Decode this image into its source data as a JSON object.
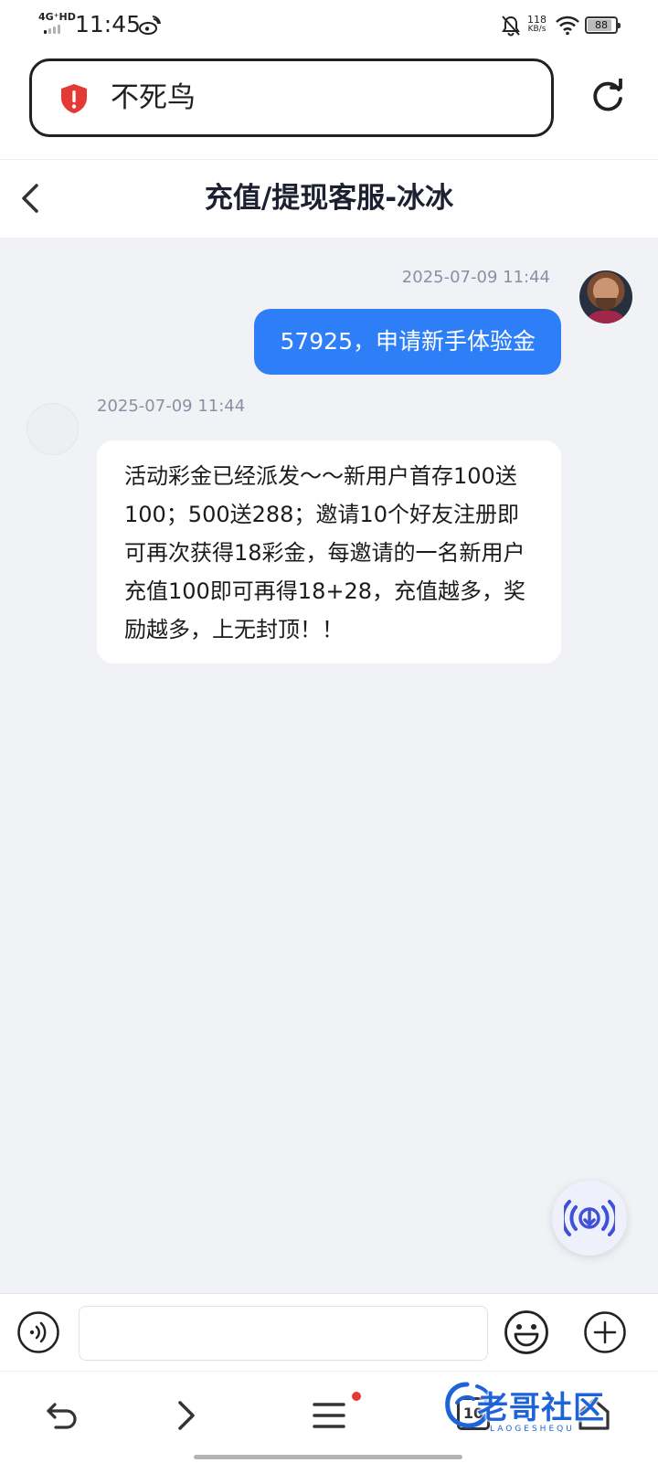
{
  "status_bar": {
    "network": "4G⁺HD",
    "time": "11:45",
    "net_speed_value": "118",
    "net_speed_unit": "KB/s",
    "battery_level": "88"
  },
  "browser": {
    "url_text": "不死鸟"
  },
  "chat": {
    "title": "充值/提现客服-冰冰"
  },
  "messages": [
    {
      "sender": "me",
      "timestamp": "2025-07-09 11:44",
      "text": "57925，申请新手体验金"
    },
    {
      "sender": "agent",
      "timestamp": "2025-07-09 11:44",
      "text": "活动彩金已经派发～～新用户首存100送100；500送288；邀请10个好友注册即可再次获得18彩金，每邀请的一名新用户充值100即可再得18+28，充值越多，奖励越多，上无封顶！！"
    }
  ],
  "input": {
    "placeholder": "",
    "value": ""
  },
  "nav": {
    "tab_count": "10"
  },
  "watermark": {
    "text": "老哥社区",
    "subtext": "LAOGESHEQU"
  },
  "colors": {
    "accent": "#2e7ff7",
    "background": "#f1f2f5",
    "shield": "#e53935",
    "watermark": "#1f63d9"
  }
}
